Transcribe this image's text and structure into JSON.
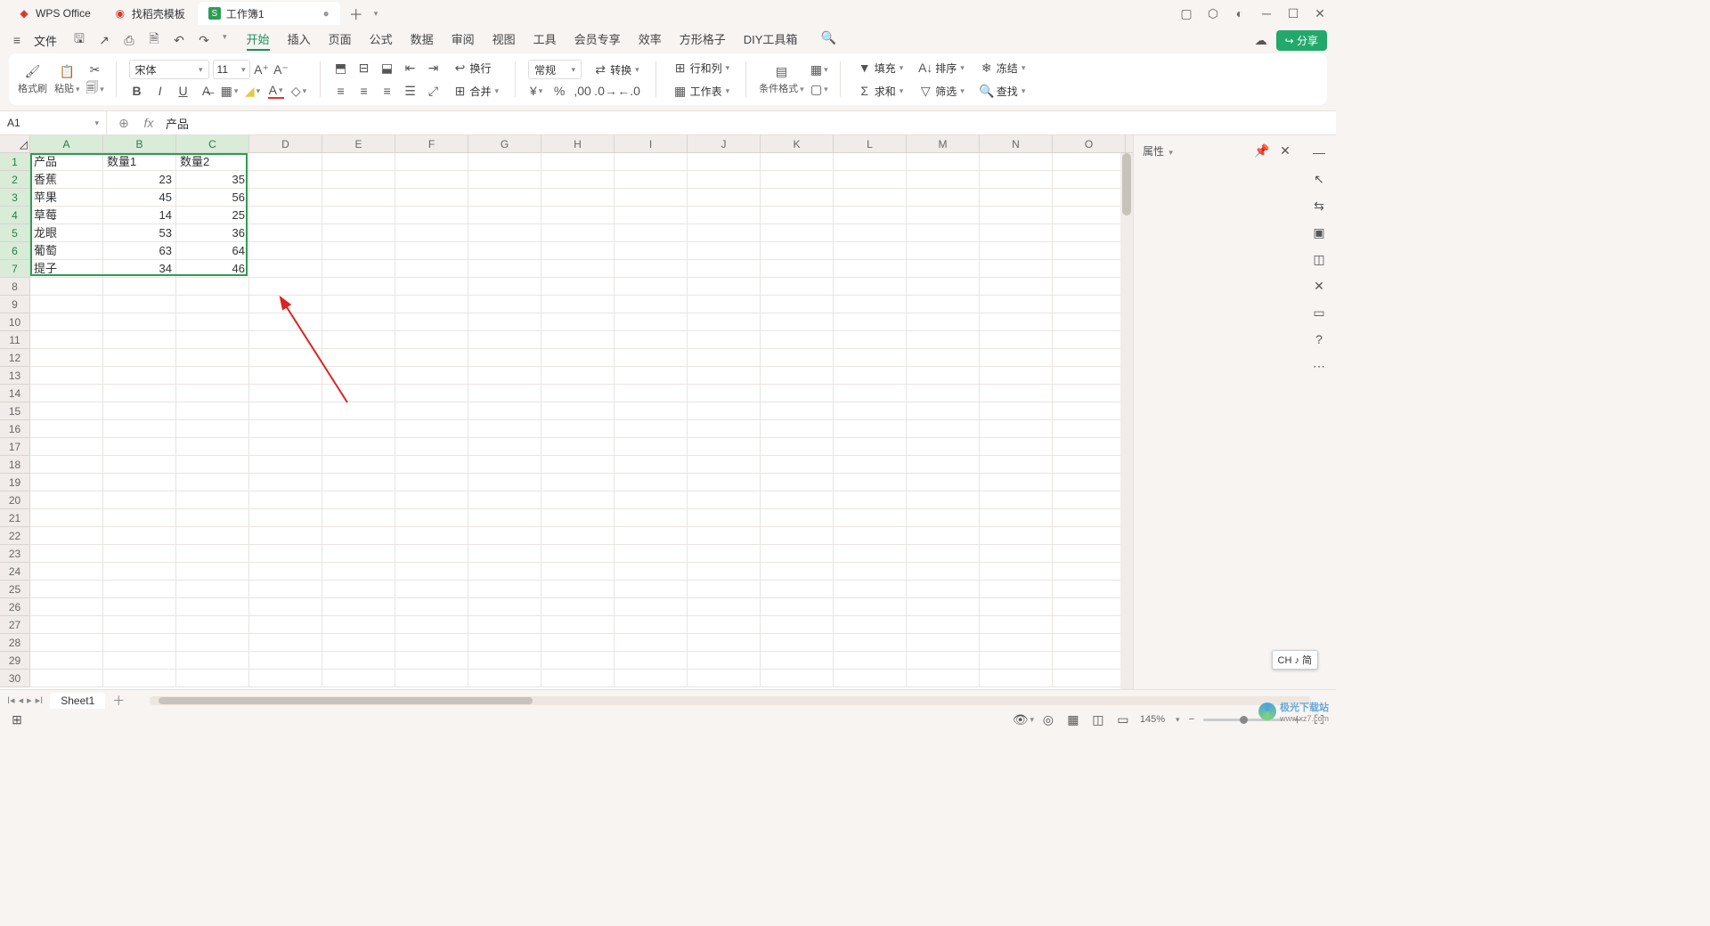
{
  "titlebar": {
    "tabs": [
      {
        "label": "WPS Office",
        "icon": "wps",
        "color": "#d83b2a"
      },
      {
        "label": "找稻壳模板",
        "icon": "docer",
        "color": "#d83b2a"
      },
      {
        "label": "工作簿1",
        "icon": "sheet",
        "color": "#2e9c57",
        "active": true,
        "modified": "●"
      }
    ]
  },
  "menu": {
    "file": "文件",
    "ribbon": [
      "开始",
      "插入",
      "页面",
      "公式",
      "数据",
      "审阅",
      "视图",
      "工具",
      "会员专享",
      "效率",
      "方形格子",
      "DIY工具箱"
    ],
    "share": "分享"
  },
  "ribbon": {
    "format_painter": "格式刷",
    "paste": "粘贴",
    "font_name": "宋体",
    "font_size": "11",
    "wrap": "换行",
    "merge": "合并",
    "number_format": "常规",
    "transpose": "转换",
    "rows_cols": "行和列",
    "worksheet": "工作表",
    "cond_format": "条件格式",
    "fill": "填充",
    "sort": "排序",
    "freeze": "冻结",
    "sum": "求和",
    "filter": "筛选",
    "find": "查找"
  },
  "formula_bar": {
    "cell_ref": "A1",
    "formula": "产品"
  },
  "grid": {
    "columns": [
      "A",
      "B",
      "C",
      "D",
      "E",
      "F",
      "G",
      "H",
      "I",
      "J",
      "K",
      "L",
      "M",
      "N",
      "O"
    ],
    "row_count": 30,
    "sel_rows": 7,
    "sel_cols": 3,
    "data": [
      [
        "产品",
        "数量1",
        "数量2"
      ],
      [
        "香蕉",
        "23",
        "35"
      ],
      [
        "苹果",
        "45",
        "56"
      ],
      [
        "草莓",
        "14",
        "25"
      ],
      [
        "龙眼",
        "53",
        "36"
      ],
      [
        "葡萄",
        "63",
        "64"
      ],
      [
        "提子",
        "34",
        "46"
      ]
    ]
  },
  "chart_data": {
    "type": "table",
    "columns": [
      "产品",
      "数量1",
      "数量2"
    ],
    "rows": [
      [
        "香蕉",
        23,
        35
      ],
      [
        "苹果",
        45,
        56
      ],
      [
        "草莓",
        14,
        25
      ],
      [
        "龙眼",
        53,
        36
      ],
      [
        "葡萄",
        63,
        64
      ],
      [
        "提子",
        34,
        46
      ]
    ]
  },
  "props": {
    "title": "属性"
  },
  "sheetbar": {
    "sheet": "Sheet1"
  },
  "status": {
    "zoom": "145%",
    "ime": "CH ♪ 简"
  },
  "watermark": {
    "brand": "极光下载站",
    "url": "www.xz7.com"
  }
}
